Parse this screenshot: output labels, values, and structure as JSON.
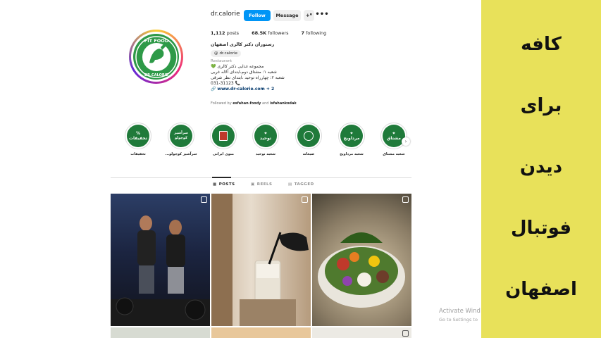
{
  "profile": {
    "username": "dr.calorie",
    "follow_label": "Follow",
    "message_label": "Message",
    "add_label": "+ₕ",
    "more_label": "•••",
    "posts_count": "1,112",
    "posts_label": "posts",
    "followers_count": "68.5K",
    "followers_label": "followers",
    "following_count": "7",
    "following_label": "following",
    "display_name": "رستوران دکتر کالری اصفهان",
    "threads_handle": "dr.calorie",
    "category": "Restaurant",
    "bio_lines": [
      "مجموعه غذایی دکتر کالری 💚",
      "شعبه ۱: مشتاق دوم،ابتدای آلاله غربی",
      "شعبه ۲: چهارراه توحید ،ابتدای نظر شرقی",
      "031-31123 📞"
    ],
    "link": "www.dr-calorie.com + 2",
    "followed_by_prefix": "Followed by",
    "followed_by_1": "esfahan.foody",
    "followed_by_and": "and",
    "followed_by_2": "isfahankodak",
    "avatar_text_top": "FIT FOOD",
    "avatar_text_bottom": "DR.CALORIE"
  },
  "highlights": [
    {
      "label": "تخفیفات",
      "circle": "%\nتخفیفات"
    },
    {
      "label": "سرآشپز کوچولو...",
      "circle": "سرآشپز کوچولو"
    },
    {
      "label": "منوی ایرانی",
      "circle": ""
    },
    {
      "label": "شعبه توحید",
      "circle": "توحید"
    },
    {
      "label": "ضیعانه",
      "circle": ""
    },
    {
      "label": "شعبه مرداویج",
      "circle": "مرداویج"
    },
    {
      "label": "شعبه مشتاق",
      "circle": "مشتاق"
    }
  ],
  "tabs": {
    "posts": "POSTS",
    "reels": "REELS",
    "tagged": "TAGGED"
  },
  "side_panel": {
    "lines": [
      "کافه",
      "برای",
      "دیدن",
      "فوتبال",
      "اصفهان"
    ]
  },
  "watermark": {
    "title": "Activate Wind",
    "subtitle": "Go to Settings to"
  },
  "colors": {
    "follow_blue": "#0095f6",
    "brand_green": "#2e9a48",
    "side_yellow": "#e8e15a"
  }
}
